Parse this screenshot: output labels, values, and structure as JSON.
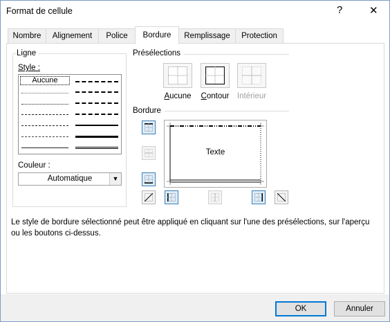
{
  "window": {
    "title": "Format de cellule",
    "help_glyph": "?",
    "close_glyph": "✕"
  },
  "tabs": [
    {
      "label": "Nombre"
    },
    {
      "label": "Alignement"
    },
    {
      "label": "Police"
    },
    {
      "label": "Bordure"
    },
    {
      "label": "Remplissage"
    },
    {
      "label": "Protection"
    }
  ],
  "line_group": {
    "title": "Ligne",
    "style_label": "Style :",
    "none_option": "Aucune",
    "color_label": "Couleur :",
    "color_value": "Automatique"
  },
  "presets_group": {
    "title": "Présélections",
    "items": [
      {
        "label": "Aucune",
        "enabled": true
      },
      {
        "label": "Contour",
        "enabled": true
      },
      {
        "label": "Intérieur",
        "enabled": false
      }
    ]
  },
  "border_group": {
    "title": "Bordure",
    "preview_text": "Texte"
  },
  "description": "Le style de bordure sélectionné peut être appliqué en cliquant sur l'une des présélections, sur l'aperçu ou les boutons ci-dessus.",
  "buttons": {
    "ok": "OK",
    "cancel": "Annuler"
  },
  "colors": {
    "accent": "#0078d7",
    "footer_bg": "#f0f0f0",
    "toggle_on_bg": "#dcecfc"
  }
}
